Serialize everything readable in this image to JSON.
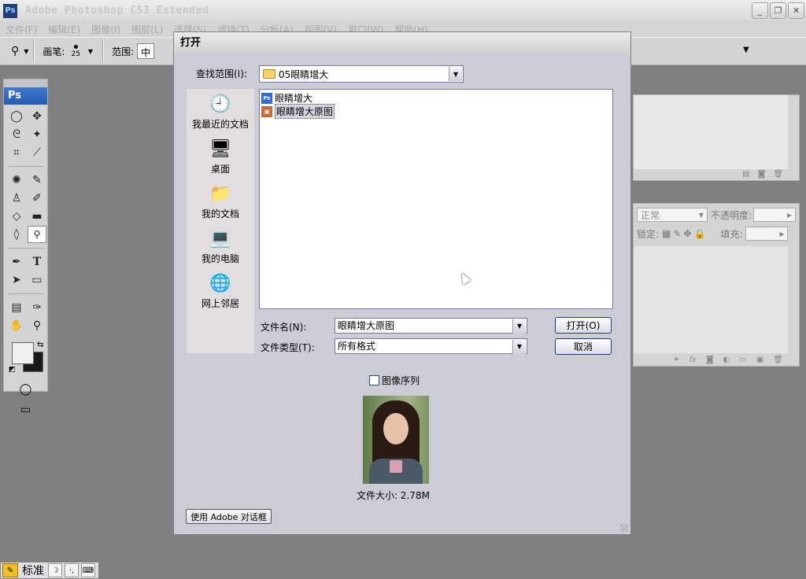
{
  "app": {
    "title": "Adobe Photoshop CS3 Extended",
    "icon_label": "Ps",
    "window_controls": [
      "minimize-icon",
      "restore-icon",
      "close-icon"
    ],
    "window_control_glyphs": [
      "_",
      "❐",
      "✕"
    ]
  },
  "menu": {
    "items": [
      "文件(F)",
      "编辑(E)",
      "图像(I)",
      "图层(L)",
      "选择(S)",
      "滤镜(T)",
      "分析(A)",
      "视图(V)",
      "窗口(W)",
      "帮助(H)"
    ]
  },
  "options_bar": {
    "brush_label": "画笔:",
    "brush_size": "25",
    "range_label": "范围:",
    "range_value": "中间调"
  },
  "tools": {
    "header": "Ps",
    "rows": [
      {
        "left": "marquee-icon",
        "left_glyph": "◯",
        "right": "move-icon",
        "right_glyph": "✥"
      },
      {
        "left": "lasso-icon",
        "left_glyph": "ᘓ",
        "right": "magic-wand-icon",
        "right_glyph": "✦"
      },
      {
        "left": "crop-icon",
        "left_glyph": "⌗",
        "right": "slice-icon",
        "right_glyph": "⟋"
      },
      {
        "left": "healing-brush-icon",
        "left_glyph": "✺",
        "right": "brush-icon",
        "right_glyph": "✎"
      },
      {
        "left": "clone-stamp-icon",
        "left_glyph": "♙",
        "right": "history-brush-icon",
        "right_glyph": "✐"
      },
      {
        "left": "eraser-icon",
        "left_glyph": "◇",
        "right": "gradient-icon",
        "right_glyph": "▬"
      },
      {
        "left": "blur-icon",
        "left_glyph": "◊",
        "right": "dodge-icon",
        "right_glyph": "🔍"
      },
      {
        "left": "pen-icon",
        "left_glyph": "✒",
        "right": "type-icon",
        "right_glyph": "T"
      },
      {
        "left": "path-selection-icon",
        "left_glyph": "➤",
        "right": "rectangle-icon",
        "right_glyph": "▭"
      },
      {
        "left": "notes-icon",
        "left_glyph": "▤",
        "right": "eyedropper-icon",
        "right_glyph": "✑"
      },
      {
        "left": "hand-icon",
        "left_glyph": "✋",
        "right": "zoom-icon",
        "right_glyph": "⚲"
      }
    ],
    "quick_mask_glyph": "◯",
    "screen_mode_glyph": "▭"
  },
  "dialog": {
    "title": "打开",
    "lookin_label": "查找范围(I):",
    "lookin_value": "05眼睛增大",
    "places": [
      {
        "label": "我最近的文档",
        "icon": "recent-documents-icon",
        "glyph": "🕘"
      },
      {
        "label": "桌面",
        "icon": "desktop-icon",
        "glyph": "🖥"
      },
      {
        "label": "我的文档",
        "icon": "my-documents-icon",
        "glyph": "📁"
      },
      {
        "label": "我的电脑",
        "icon": "my-computer-icon",
        "glyph": "💻"
      },
      {
        "label": "网上邻居",
        "icon": "network-icon",
        "glyph": "🌐"
      }
    ],
    "files": [
      {
        "name": "眼睛增大",
        "type": "psd",
        "icon_label": "Ps",
        "selected": false
      },
      {
        "name": "眼睛增大原图",
        "type": "image",
        "icon_label": "▣",
        "selected": true
      }
    ],
    "filename_label": "文件名(N):",
    "filename_value": "眼睛增大原图",
    "filetype_label": "文件类型(T):",
    "filetype_value": "所有格式",
    "open_button": "打开(O)",
    "cancel_button": "取消",
    "sequence_label": "图像序列",
    "sequence_checked": false,
    "filesize": "文件大小: 2.78M",
    "adobe_dialog_button": "使用 Adobe 对话框"
  },
  "layers_panel": {
    "blend_mode": "正常",
    "opacity_label": "不透明度:",
    "lock_label": "锁定:",
    "fill_label": "填充:"
  },
  "ime": {
    "mode": "标准"
  }
}
